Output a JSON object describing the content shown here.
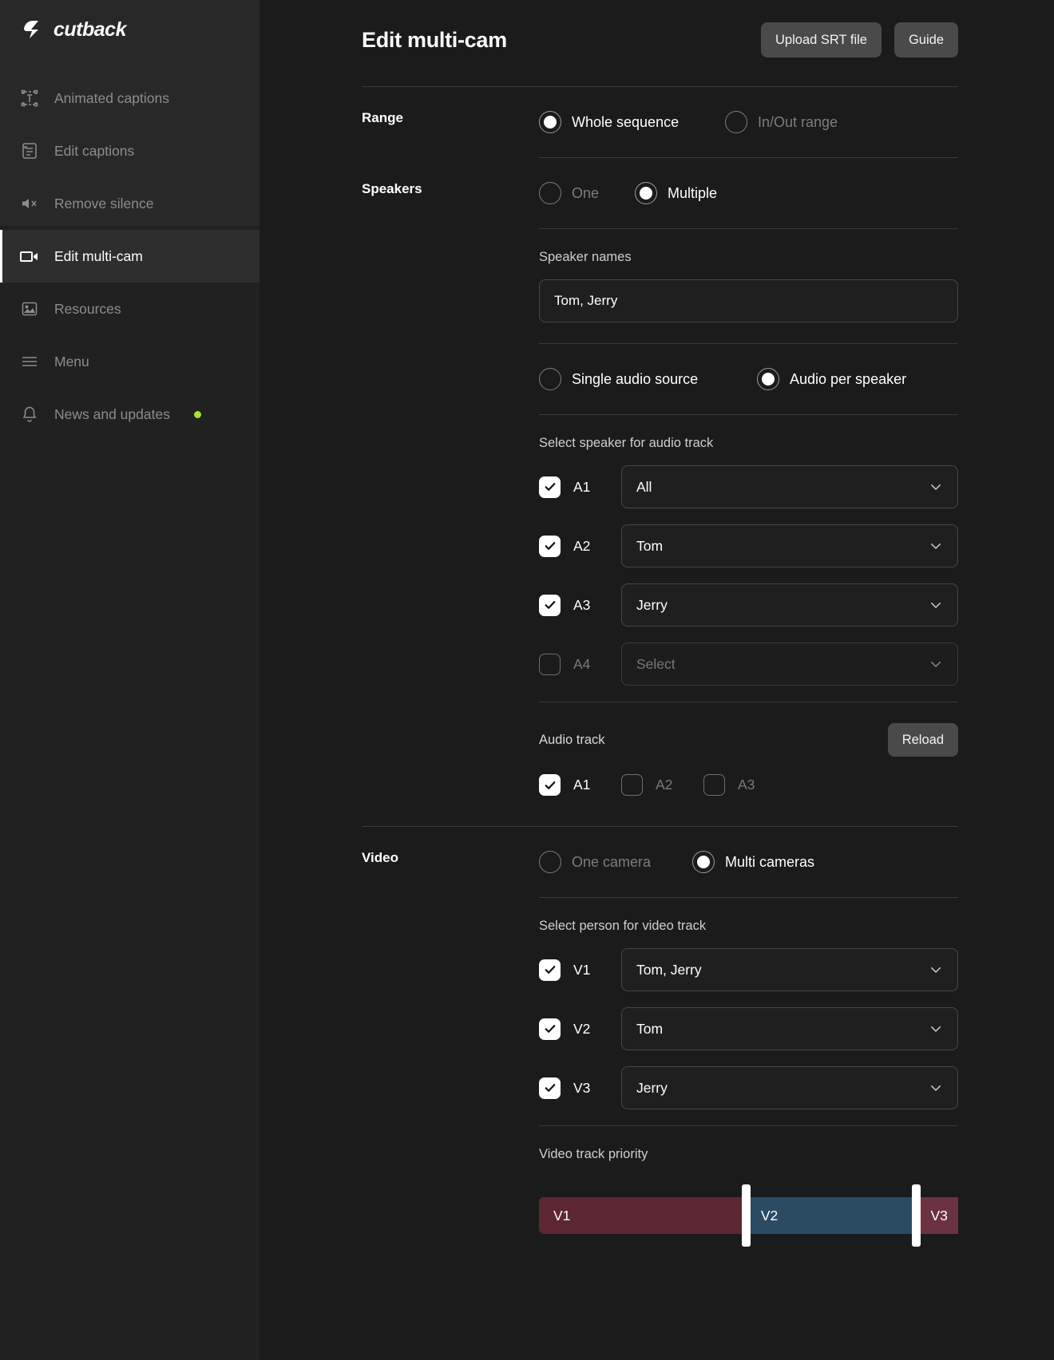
{
  "brand": {
    "name": "cutback",
    "logo_icon": "lightning-bolt-icon"
  },
  "sidebar": {
    "items": [
      {
        "label": "Animated captions",
        "icon": "animated-text-icon",
        "active": false
      },
      {
        "label": "Edit captions",
        "icon": "captions-document-icon",
        "active": false
      },
      {
        "label": "Remove silence",
        "icon": "speaker-mute-icon",
        "active": false
      },
      {
        "label": "Edit multi-cam",
        "icon": "video-camera-icon",
        "active": true
      },
      {
        "label": "Resources",
        "icon": "image-icon",
        "active": false
      },
      {
        "label": "Menu",
        "icon": "hamburger-menu-icon",
        "active": false
      },
      {
        "label": "News and updates",
        "icon": "bell-icon",
        "active": false,
        "badge_dot": true
      }
    ],
    "badge_dot_color": "#a6e22e"
  },
  "header": {
    "title": "Edit multi-cam",
    "upload_srt_label": "Upload SRT file",
    "guide_label": "Guide"
  },
  "range": {
    "label": "Range",
    "options": [
      {
        "label": "Whole sequence",
        "selected": true
      },
      {
        "label": "In/Out range",
        "selected": false
      }
    ]
  },
  "speakers": {
    "label": "Speakers",
    "mode_options": [
      {
        "label": "One",
        "selected": false
      },
      {
        "label": "Multiple",
        "selected": true
      }
    ],
    "speaker_names_title": "Speaker names",
    "speaker_names_value": "Tom, Jerry",
    "speaker_names_placeholder": "Speaker names",
    "audio_source_options": [
      {
        "label": "Single audio source",
        "selected": false
      },
      {
        "label": "Audio per speaker",
        "selected": true
      }
    ],
    "select_speaker_title": "Select speaker for audio track",
    "tracks": [
      {
        "id": "A1",
        "checked": true,
        "value": "All",
        "placeholder": "Select"
      },
      {
        "id": "A2",
        "checked": true,
        "value": "Tom",
        "placeholder": "Select"
      },
      {
        "id": "A3",
        "checked": true,
        "value": "Jerry",
        "placeholder": "Select"
      },
      {
        "id": "A4",
        "checked": false,
        "value": "",
        "placeholder": "Select"
      }
    ],
    "audio_track_title": "Audio track",
    "reload_label": "Reload",
    "audio_tracks": [
      {
        "id": "A1",
        "checked": true
      },
      {
        "id": "A2",
        "checked": false
      },
      {
        "id": "A3",
        "checked": false
      }
    ]
  },
  "video": {
    "label": "Video",
    "mode_options": [
      {
        "label": "One camera",
        "selected": false
      },
      {
        "label": "Multi cameras",
        "selected": true
      }
    ],
    "select_person_title": "Select person for video track",
    "tracks": [
      {
        "id": "V1",
        "checked": true,
        "value": "Tom, Jerry",
        "placeholder": "Select"
      },
      {
        "id": "V2",
        "checked": true,
        "value": "Tom",
        "placeholder": "Select"
      },
      {
        "id": "V3",
        "checked": true,
        "value": "Jerry",
        "placeholder": "Select"
      }
    ],
    "priority_title": "Video track priority",
    "priority_segments": [
      {
        "label": "V1",
        "width_pct": 49.5,
        "color": "#5c2733"
      },
      {
        "label": "V2",
        "width_pct": 40.5,
        "color": "#2b4b63"
      },
      {
        "label": "V3",
        "width_pct": 10.0,
        "color": "#6b3341"
      }
    ]
  }
}
